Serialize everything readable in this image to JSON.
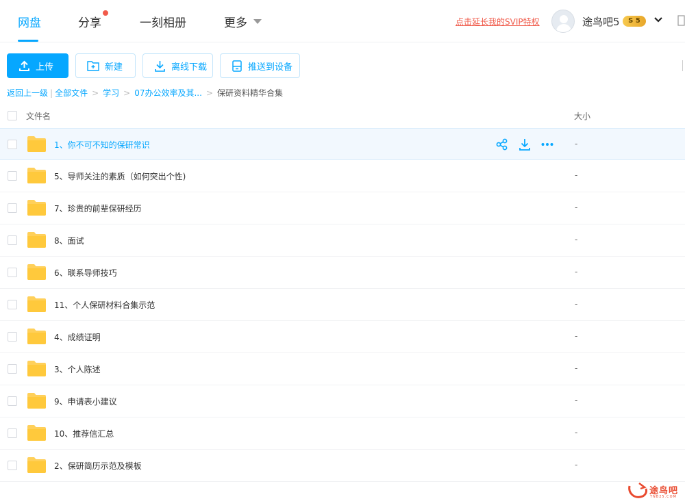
{
  "nav": {
    "tabs": [
      {
        "label": "网盘",
        "active": true
      },
      {
        "label": "分享",
        "has_dot": true
      },
      {
        "label": "一刻相册"
      },
      {
        "label": "更多"
      }
    ],
    "svip_link": "点击延长我的SVIP特权",
    "username": "途鸟吧5",
    "badge": "S 5",
    "accent_color": "#06a7ff"
  },
  "toolbar": {
    "upload_label": "上传",
    "new_label": "新建",
    "offline_label": "离线下载",
    "push_label": "推送到设备"
  },
  "breadcrumb": {
    "back": "返回上一级",
    "items": [
      "全部文件",
      "学习",
      "07办公效率及其...",
      "保研资料精华合集"
    ]
  },
  "table": {
    "col_name": "文件名",
    "col_size": "大小",
    "rows": [
      {
        "name": "1、你不可不知的保研常识",
        "size": "-",
        "hovered": true
      },
      {
        "name": "5、导师关注的素质（如何突出个性)",
        "size": "-"
      },
      {
        "name": "7、珍贵的前辈保研经历",
        "size": "-"
      },
      {
        "name": "8、面试",
        "size": "-"
      },
      {
        "name": "6、联系导师技巧",
        "size": "-"
      },
      {
        "name": "11、个人保研材料合集示范",
        "size": "-"
      },
      {
        "name": "4、成绩证明",
        "size": "-"
      },
      {
        "name": "3、个人陈述",
        "size": "-"
      },
      {
        "name": "9、申请表小建议",
        "size": "-"
      },
      {
        "name": "10、推荐信汇总",
        "size": "-"
      },
      {
        "name": "2、保研简历示范及模板",
        "size": "-"
      }
    ]
  },
  "watermark": {
    "text": "途鸟吧",
    "sub": "TNB25.COM"
  }
}
